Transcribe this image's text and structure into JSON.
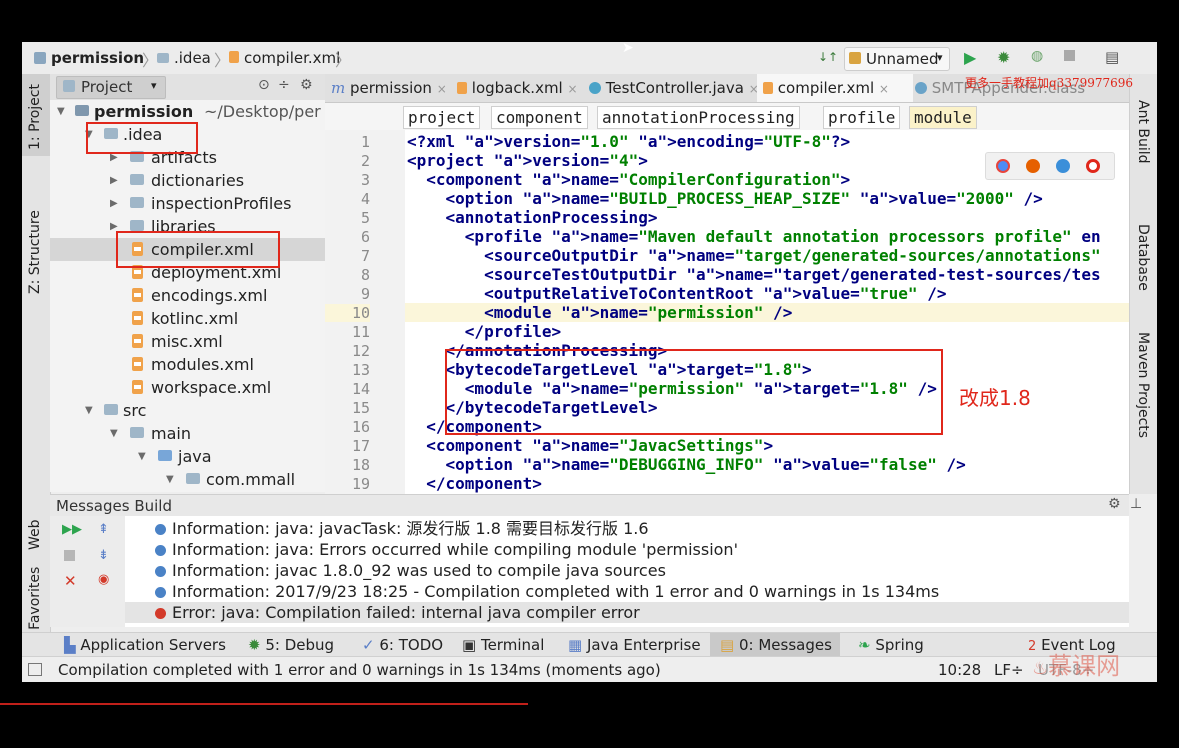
{
  "breadcrumb": {
    "items": [
      "permission",
      ".idea",
      "compiler.xml"
    ]
  },
  "toolbar": {
    "run_config": "Unnamed",
    "run_config_arrow": "▾",
    "vcs_arrows": "↓↑"
  },
  "left_strip": {
    "project": "1: Project",
    "structure": "Z: Structure",
    "web": "Web",
    "favorites": "2: Favorites"
  },
  "right_strip": {
    "ant": "Ant Build",
    "database": "Database",
    "maven": "Maven Projects"
  },
  "project_panel": {
    "title": "Project",
    "title_arrow": "▾",
    "tree": [
      {
        "label": "permission",
        "suffix": "~/Desktop/per",
        "depth": 0,
        "type": "module"
      },
      {
        "label": ".idea",
        "depth": 1,
        "type": "folder"
      },
      {
        "label": "artifacts",
        "depth": 2,
        "type": "folder"
      },
      {
        "label": "dictionaries",
        "depth": 2,
        "type": "folder"
      },
      {
        "label": "inspectionProfiles",
        "depth": 2,
        "type": "folder"
      },
      {
        "label": "libraries",
        "depth": 2,
        "type": "folder"
      },
      {
        "label": "compiler.xml",
        "depth": 2,
        "type": "xml",
        "selected": true
      },
      {
        "label": "deployment.xml",
        "depth": 2,
        "type": "xml"
      },
      {
        "label": "encodings.xml",
        "depth": 2,
        "type": "xml"
      },
      {
        "label": "kotlinc.xml",
        "depth": 2,
        "type": "xml"
      },
      {
        "label": "misc.xml",
        "depth": 2,
        "type": "xml"
      },
      {
        "label": "modules.xml",
        "depth": 2,
        "type": "xml"
      },
      {
        "label": "workspace.xml",
        "depth": 2,
        "type": "xml"
      },
      {
        "label": "src",
        "depth": 1,
        "type": "folder"
      },
      {
        "label": "main",
        "depth": 2,
        "type": "folder"
      },
      {
        "label": "java",
        "depth": 3,
        "type": "folder"
      },
      {
        "label": "com.mmall",
        "depth": 4,
        "type": "folder"
      }
    ]
  },
  "editor_tabs": [
    {
      "label": "permission",
      "prefix": "m"
    },
    {
      "label": "logback.xml"
    },
    {
      "label": "TestController.java"
    },
    {
      "label": "compiler.xml",
      "active": true
    },
    {
      "label": "SMTPAppender.class"
    }
  ],
  "watermark": {
    "text": "更多一手教程加q3379977696"
  },
  "xml_breadcrumb": [
    "project",
    "component",
    "annotationProcessing",
    "profile",
    "module"
  ],
  "code": {
    "line_numbers": [
      "1",
      "2",
      "3",
      "4",
      "5",
      "6",
      "7",
      "8",
      "9",
      "10",
      "11",
      "12",
      "13",
      "14",
      "15",
      "16",
      "17",
      "18",
      "19"
    ],
    "lines": [
      "<?xml version=\"1.0\" encoding=\"UTF-8\"?>",
      "<project version=\"4\">",
      "  <component name=\"CompilerConfiguration\">",
      "    <option name=\"BUILD_PROCESS_HEAP_SIZE\" value=\"2000\" />",
      "    <annotationProcessing>",
      "      <profile name=\"Maven default annotation processors profile\" en",
      "        <sourceOutputDir name=\"target/generated-sources/annotations\"",
      "        <sourceTestOutputDir name=\"target/generated-test-sources/tes",
      "        <outputRelativeToContentRoot value=\"true\" />",
      "        <module name=\"permission\" />",
      "      </profile>",
      "    </annotationProcessing>",
      "    <bytecodeTargetLevel target=\"1.8\">",
      "      <module name=\"permission\" target=\"1.8\" />",
      "    </bytecodeTargetLevel>",
      "  </component>",
      "  <component name=\"JavacSettings\">",
      "    <option name=\"DEBUGGING_INFO\" value=\"false\" />",
      "  </component>"
    ]
  },
  "annotation": {
    "text": "改成1.8"
  },
  "messages_panel": {
    "title": "Messages Build",
    "items": [
      {
        "level": "info",
        "text": "Information: java: javacTask: 源发行版 1.8 需要目标发行版 1.6"
      },
      {
        "level": "info",
        "text": "Information: java: Errors occurred while compiling module 'permission'"
      },
      {
        "level": "info",
        "text": "Information: javac 1.8.0_92 was used to compile java sources"
      },
      {
        "level": "info",
        "text": "Information: 2017/9/23 18:25 - Compilation completed with 1 error and 0 warnings in 1s 134ms"
      },
      {
        "level": "error",
        "text": "Error: java: Compilation failed: internal java compiler error"
      }
    ]
  },
  "tool_tabs": [
    {
      "label": "Application Servers"
    },
    {
      "label": "5: Debug"
    },
    {
      "label": "6: TODO"
    },
    {
      "label": "Terminal"
    },
    {
      "label": "Java Enterprise"
    },
    {
      "label": "0: Messages",
      "active": true
    },
    {
      "label": "Spring"
    },
    {
      "label": "Event Log",
      "badge": "2"
    }
  ],
  "status_bar": {
    "message": "Compilation completed with 1 error and 0 warnings in 1s 134ms (moments ago)",
    "position": "10:28",
    "line_sep": "LF÷",
    "encoding": "UTF-8÷"
  },
  "logo": {
    "text": "慕课网"
  },
  "colors": {
    "highlight_box": "#e0271b",
    "xml_tag": "#000080",
    "xml_attr": "#0000ff",
    "xml_value": "#008000"
  }
}
